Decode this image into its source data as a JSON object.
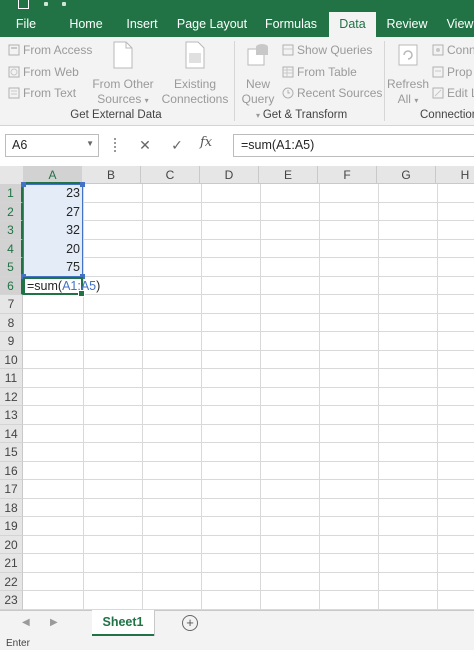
{
  "ribbon_tabs": [
    {
      "label": "File"
    },
    {
      "label": "Home"
    },
    {
      "label": "Insert"
    },
    {
      "label": "Page Layout"
    },
    {
      "label": "Formulas"
    },
    {
      "label": "Data",
      "active": true
    },
    {
      "label": "Review"
    },
    {
      "label": "View"
    }
  ],
  "ribbon": {
    "get_external": {
      "from_access": "From Access",
      "from_web": "From Web",
      "from_text": "From Text",
      "from_other_line1": "From Other",
      "from_other_line2": "Sources",
      "existing_line1": "Existing",
      "existing_line2": "Connections",
      "label": "Get External Data"
    },
    "get_transform": {
      "new_query_line1": "New",
      "new_query_line2": "Query",
      "show_queries": "Show Queries",
      "from_table": "From Table",
      "recent_sources": "Recent Sources",
      "label": "Get & Transform"
    },
    "connections": {
      "refresh_line1": "Refresh",
      "refresh_line2": "All",
      "connections": "Conn",
      "properties": "Prop",
      "edit_links": "Edit Li",
      "label": "Connection"
    }
  },
  "formula_bar": {
    "name_box": "A6",
    "formula": "=sum(A1:A5)",
    "cancel": "✕",
    "enter": "✓",
    "fx": "fx"
  },
  "columns": [
    "A",
    "B",
    "C",
    "D",
    "E",
    "F",
    "G",
    "H"
  ],
  "rows": [
    "1",
    "2",
    "3",
    "4",
    "5",
    "6",
    "7",
    "8",
    "9",
    "10",
    "11",
    "12",
    "13",
    "14",
    "15",
    "16",
    "17",
    "18",
    "19",
    "20",
    "21",
    "22",
    "23"
  ],
  "cells": {
    "A1": "23",
    "A2": "27",
    "A3": "32",
    "A4": "20",
    "A5": "75"
  },
  "active_cell": {
    "prefix": "=sum(",
    "ref": "A1:A5",
    "suffix": ")"
  },
  "sheets": [
    {
      "name": "Sheet1"
    }
  ],
  "add_sheet": "+",
  "status": "Enter",
  "colors": {
    "accent": "#217346",
    "reference": "#4472c4"
  }
}
